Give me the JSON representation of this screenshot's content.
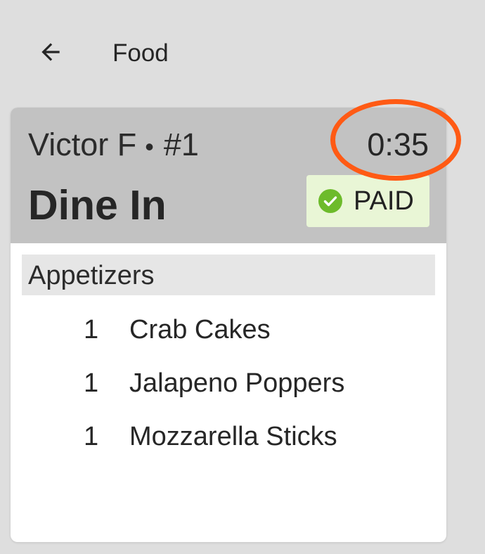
{
  "header": {
    "back_icon": "arrow-left-icon",
    "title": "Food"
  },
  "order": {
    "customer_name": "Victor F",
    "separator": "•",
    "order_number": "#1",
    "elapsed_time": "0:35",
    "order_type": "Dine In",
    "payment_status": "PAID",
    "payment_icon": "check-circle-icon",
    "sections": [
      {
        "label": "Appetizers",
        "items": [
          {
            "qty": "1",
            "name": "Crab Cakes"
          },
          {
            "qty": "1",
            "name": "Jalapeno Poppers"
          },
          {
            "qty": "1",
            "name": "Mozzarella Sticks"
          }
        ]
      }
    ]
  },
  "colors": {
    "background": "#dedede",
    "card_header": "#c2c2c2",
    "paid_badge_bg": "#e9f6d6",
    "paid_check": "#6dbb2b",
    "highlight_ring": "#ff5a14"
  }
}
